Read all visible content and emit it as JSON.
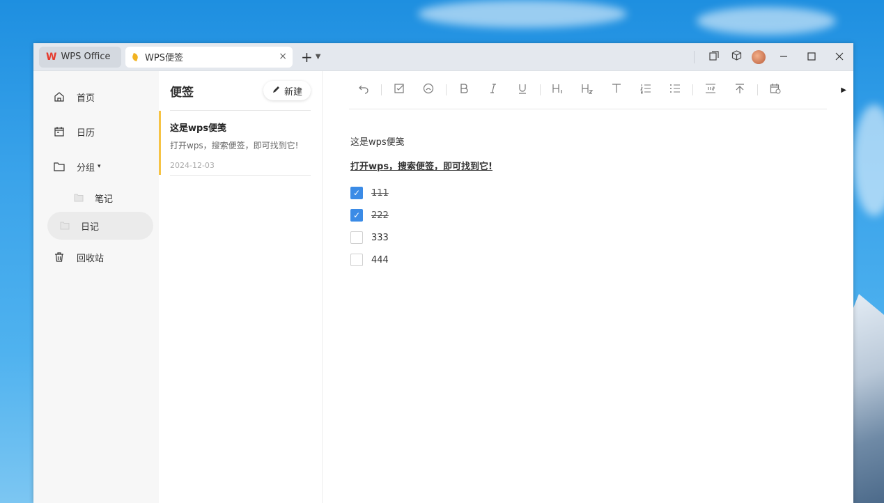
{
  "titlebar": {
    "home_tab_label": "WPS Office",
    "home_tab_logo": "W",
    "active_tab_label": "WPS便签",
    "close_symbol": "×",
    "new_tab_symbol": "+",
    "dropdown_symbol": "⌄",
    "icons": [
      "restore-pages-icon",
      "box-icon",
      "avatar"
    ],
    "window_controls": {
      "minimize": "—",
      "maximize": "☐",
      "close": "✕"
    }
  },
  "sidebar": {
    "items": [
      {
        "label": "首页",
        "icon": "home-icon"
      },
      {
        "label": "日历",
        "icon": "calendar-icon"
      },
      {
        "label": "分组",
        "icon": "folder-icon"
      },
      {
        "label": "回收站",
        "icon": "trash-icon"
      }
    ],
    "groups": [
      {
        "label": "笔记"
      },
      {
        "label": "日记"
      }
    ],
    "caret": "▾"
  },
  "notelist": {
    "title": "便签",
    "new_button": "新建",
    "notes": [
      {
        "title": "这是wps便笺",
        "snippet": "打开wps，搜索便签，即可找到它!",
        "date": "2024-12-03"
      }
    ]
  },
  "editor": {
    "toolbar": [
      "undo-icon",
      "checkbox-icon",
      "emoji-icon",
      "bold-icon",
      "italic-icon",
      "underline-icon",
      "heading1-icon",
      "heading2-icon",
      "text-icon",
      "ordered-list-icon",
      "bullet-list-icon",
      "indent-icon",
      "pin-top-icon",
      "calendar-icon"
    ],
    "line1": "这是wps便笺",
    "line2": "打开wps，搜索便签，即可找到它!",
    "checklist": [
      {
        "label": "111",
        "checked": true
      },
      {
        "label": "222",
        "checked": true
      },
      {
        "label": "333",
        "checked": false
      },
      {
        "label": "444",
        "checked": false
      }
    ]
  },
  "colors": {
    "accent": "#3b8be6",
    "note_bar": "#f6c344",
    "wps_red": "#e63b2e"
  }
}
